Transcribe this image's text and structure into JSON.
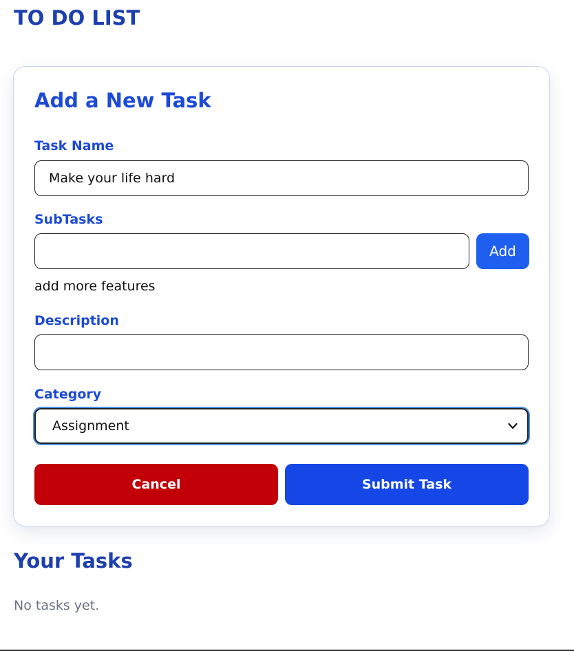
{
  "app": {
    "title": "TO DO LIST"
  },
  "form": {
    "title": "Add a New Task",
    "task_name": {
      "label": "Task Name",
      "value": "Make your life hard",
      "placeholder": ""
    },
    "subtasks": {
      "label": "SubTasks",
      "value": "",
      "placeholder": "",
      "add_label": "Add",
      "items": [
        "add more features"
      ]
    },
    "description": {
      "label": "Description",
      "value": "",
      "placeholder": ""
    },
    "category": {
      "label": "Category",
      "selected": "Assignment"
    },
    "cancel_label": "Cancel",
    "submit_label": "Submit Task"
  },
  "tasks": {
    "title": "Your Tasks",
    "empty_message": "No tasks yet."
  },
  "colors": {
    "heading": "#1e3fae",
    "accent": "#1c4ad6",
    "add_button": "#1e5ff0",
    "cancel": "#c10007",
    "submit": "#1447e6",
    "muted_text": "#6b7280"
  }
}
